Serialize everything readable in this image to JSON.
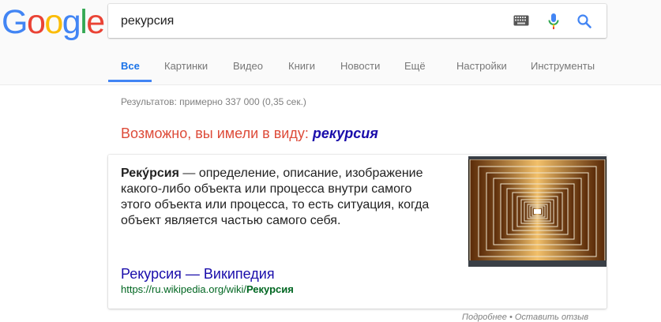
{
  "logo": {
    "letters": [
      "G",
      "o",
      "o",
      "g",
      "l",
      "e"
    ]
  },
  "colors": {
    "blue": "#4285f4",
    "red": "#ea4335",
    "yellow": "#fbbc05",
    "green": "#34a853",
    "link": "#1a0dab",
    "url_green": "#006621",
    "suggest_red": "#dd4b39"
  },
  "search": {
    "query": "рекурсия"
  },
  "icons": {
    "keyboard": "keyboard-icon",
    "mic": "mic-icon",
    "search": "search-icon"
  },
  "tabs": [
    {
      "label": "Все",
      "active": true
    },
    {
      "label": "Картинки"
    },
    {
      "label": "Видео"
    },
    {
      "label": "Книги"
    },
    {
      "label": "Новости"
    },
    {
      "label": "Ещё"
    },
    {
      "label": "Настройки"
    },
    {
      "label": "Инструменты"
    }
  ],
  "results": {
    "stats": "Результатов: примерно 337 000 (0,35 сек.)"
  },
  "did_you_mean": {
    "prefix": "Возможно, вы имели в виду:",
    "suggestion": "рекурсия"
  },
  "knowledge_card": {
    "term": "Реку́рсия",
    "definition": " — определение, описание, изображение какого-либо объекта или процесса внутри самого этого объекта или процесса, то есть ситуация, когда объект является частью самого себя.",
    "source_title": "Рекурсия — Википедия",
    "source_url_prefix": "https://ru.wikipedia.org/wiki/",
    "source_url_bold": "Рекурсия"
  },
  "footer": {
    "more": "Подробнее",
    "separator": "•",
    "feedback": "Оставить отзыв"
  }
}
